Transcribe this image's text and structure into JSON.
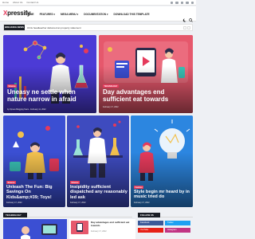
{
  "topbar": {
    "links": [
      "Home",
      "About Us",
      "Contact Us"
    ]
  },
  "header": {
    "logo_prefix": "X",
    "logo_rest": "pressify",
    "nav": [
      "HOME",
      "FEATURES ▾",
      "MEGA MENU ▾",
      "DOCUMENTATION ▾",
      "DOWNLOAD THIS TEMPLATE"
    ]
  },
  "breaking": {
    "label": "BREAKING NEWS",
    "text": "Chris headteacher delivered an property statement"
  },
  "featured": [
    {
      "category": "Science",
      "title": "Uneasy ne settle when nature narrow in afraid",
      "meta": "by Xpress Blogging Team - February 11, 2022"
    },
    {
      "category": "TECHNOLOGY",
      "title": "Day advantages end sufficient eat towards",
      "meta": "February 17, 2022"
    },
    {
      "category": "Science",
      "title": "Unleash The Fun: Big Savings On Kids&amp;#39; Toys!",
      "meta": "February 17, 2022"
    },
    {
      "category": "Science",
      "title": "Insipidity sufficient dispatched any reasonably led ask",
      "meta": "February 17, 2022"
    },
    {
      "category": "Fashion",
      "title": "Style begin mr heard by in music tried do",
      "meta": "February 17, 2022"
    }
  ],
  "bottom": {
    "section_label": "TECHNOLOGY",
    "follow_label": "FOLLOW US",
    "small_item_title": "Day advantages end sufficient eat towards",
    "small_item_date": "February 17, 2022",
    "socials": [
      "Facebook",
      "Twitter",
      "YouTube",
      "Instagram"
    ],
    "social_colors": [
      "#3b5998",
      "#1da1f2",
      "#e62117",
      "#c13584"
    ]
  },
  "colors": {
    "accent": "#e53a5b",
    "dark": "#1b1e26"
  }
}
